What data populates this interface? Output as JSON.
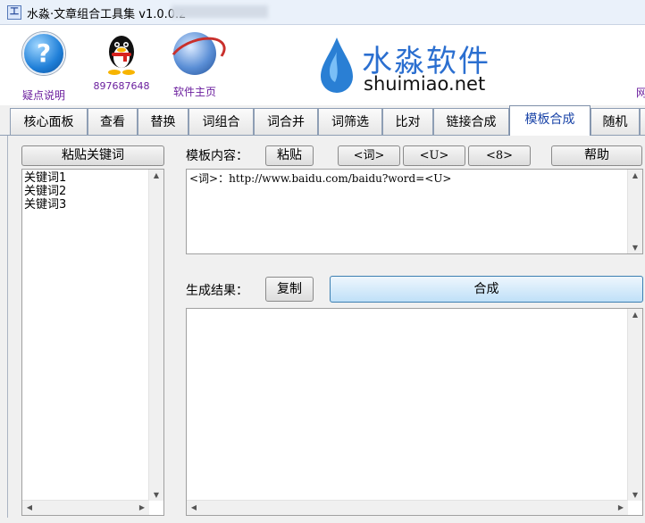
{
  "window": {
    "title": "水淼·文章组合工具集 v1.0.0.2"
  },
  "banner": {
    "help_label": "疑点说明",
    "qq_label": "897687648",
    "home_label": "软件主页",
    "logo_cn": "水淼软件",
    "logo_en": "shuimiao.net",
    "right_cut_label": "网"
  },
  "tabs": [
    "核心面板",
    "查看",
    "替换",
    "词组合",
    "词合并",
    "词筛选",
    "比对",
    "链接合成",
    "模板合成",
    "随机"
  ],
  "active_tab": "模板合成",
  "left": {
    "paste_keywords_button": "粘贴关键词",
    "keywords": [
      "关键词1",
      "关键词2",
      "关键词3"
    ]
  },
  "template": {
    "label": "模板内容：",
    "paste_button": "粘贴",
    "insert_word_button": "<词>",
    "insert_u_button": "<U>",
    "insert_8_button": "<8>",
    "help_button": "帮助",
    "content": "<词>：http://www.baidu.com/baidu?word=<U>"
  },
  "result": {
    "label": "生成结果：",
    "copy_button": "复制",
    "compose_button": "合成",
    "content": ""
  },
  "colors": {
    "accent": "#2b6fd0",
    "link_purple": "#6b1f9e"
  }
}
